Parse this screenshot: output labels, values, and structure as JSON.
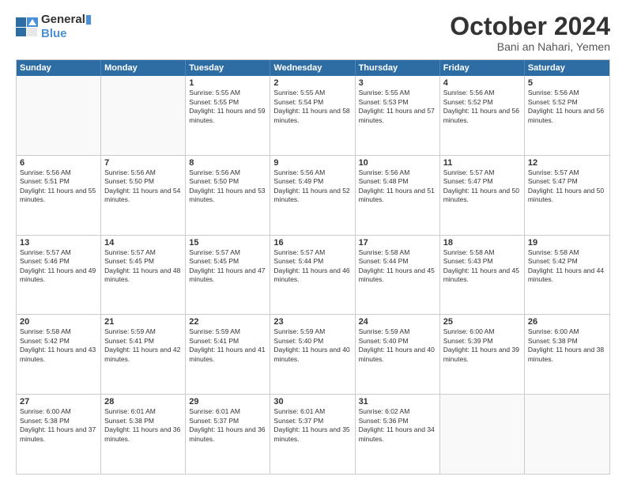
{
  "logo": {
    "line1": "General",
    "line2": "Blue"
  },
  "title": "October 2024",
  "location": "Bani an Nahari, Yemen",
  "header_days": [
    "Sunday",
    "Monday",
    "Tuesday",
    "Wednesday",
    "Thursday",
    "Friday",
    "Saturday"
  ],
  "weeks": [
    [
      {
        "day": "",
        "sunrise": "",
        "sunset": "",
        "daylight": ""
      },
      {
        "day": "",
        "sunrise": "",
        "sunset": "",
        "daylight": ""
      },
      {
        "day": "1",
        "sunrise": "Sunrise: 5:55 AM",
        "sunset": "Sunset: 5:55 PM",
        "daylight": "Daylight: 11 hours and 59 minutes."
      },
      {
        "day": "2",
        "sunrise": "Sunrise: 5:55 AM",
        "sunset": "Sunset: 5:54 PM",
        "daylight": "Daylight: 11 hours and 58 minutes."
      },
      {
        "day": "3",
        "sunrise": "Sunrise: 5:55 AM",
        "sunset": "Sunset: 5:53 PM",
        "daylight": "Daylight: 11 hours and 57 minutes."
      },
      {
        "day": "4",
        "sunrise": "Sunrise: 5:56 AM",
        "sunset": "Sunset: 5:52 PM",
        "daylight": "Daylight: 11 hours and 56 minutes."
      },
      {
        "day": "5",
        "sunrise": "Sunrise: 5:56 AM",
        "sunset": "Sunset: 5:52 PM",
        "daylight": "Daylight: 11 hours and 56 minutes."
      }
    ],
    [
      {
        "day": "6",
        "sunrise": "Sunrise: 5:56 AM",
        "sunset": "Sunset: 5:51 PM",
        "daylight": "Daylight: 11 hours and 55 minutes."
      },
      {
        "day": "7",
        "sunrise": "Sunrise: 5:56 AM",
        "sunset": "Sunset: 5:50 PM",
        "daylight": "Daylight: 11 hours and 54 minutes."
      },
      {
        "day": "8",
        "sunrise": "Sunrise: 5:56 AM",
        "sunset": "Sunset: 5:50 PM",
        "daylight": "Daylight: 11 hours and 53 minutes."
      },
      {
        "day": "9",
        "sunrise": "Sunrise: 5:56 AM",
        "sunset": "Sunset: 5:49 PM",
        "daylight": "Daylight: 11 hours and 52 minutes."
      },
      {
        "day": "10",
        "sunrise": "Sunrise: 5:56 AM",
        "sunset": "Sunset: 5:48 PM",
        "daylight": "Daylight: 11 hours and 51 minutes."
      },
      {
        "day": "11",
        "sunrise": "Sunrise: 5:57 AM",
        "sunset": "Sunset: 5:47 PM",
        "daylight": "Daylight: 11 hours and 50 minutes."
      },
      {
        "day": "12",
        "sunrise": "Sunrise: 5:57 AM",
        "sunset": "Sunset: 5:47 PM",
        "daylight": "Daylight: 11 hours and 50 minutes."
      }
    ],
    [
      {
        "day": "13",
        "sunrise": "Sunrise: 5:57 AM",
        "sunset": "Sunset: 5:46 PM",
        "daylight": "Daylight: 11 hours and 49 minutes."
      },
      {
        "day": "14",
        "sunrise": "Sunrise: 5:57 AM",
        "sunset": "Sunset: 5:45 PM",
        "daylight": "Daylight: 11 hours and 48 minutes."
      },
      {
        "day": "15",
        "sunrise": "Sunrise: 5:57 AM",
        "sunset": "Sunset: 5:45 PM",
        "daylight": "Daylight: 11 hours and 47 minutes."
      },
      {
        "day": "16",
        "sunrise": "Sunrise: 5:57 AM",
        "sunset": "Sunset: 5:44 PM",
        "daylight": "Daylight: 11 hours and 46 minutes."
      },
      {
        "day": "17",
        "sunrise": "Sunrise: 5:58 AM",
        "sunset": "Sunset: 5:44 PM",
        "daylight": "Daylight: 11 hours and 45 minutes."
      },
      {
        "day": "18",
        "sunrise": "Sunrise: 5:58 AM",
        "sunset": "Sunset: 5:43 PM",
        "daylight": "Daylight: 11 hours and 45 minutes."
      },
      {
        "day": "19",
        "sunrise": "Sunrise: 5:58 AM",
        "sunset": "Sunset: 5:42 PM",
        "daylight": "Daylight: 11 hours and 44 minutes."
      }
    ],
    [
      {
        "day": "20",
        "sunrise": "Sunrise: 5:58 AM",
        "sunset": "Sunset: 5:42 PM",
        "daylight": "Daylight: 11 hours and 43 minutes."
      },
      {
        "day": "21",
        "sunrise": "Sunrise: 5:59 AM",
        "sunset": "Sunset: 5:41 PM",
        "daylight": "Daylight: 11 hours and 42 minutes."
      },
      {
        "day": "22",
        "sunrise": "Sunrise: 5:59 AM",
        "sunset": "Sunset: 5:41 PM",
        "daylight": "Daylight: 11 hours and 41 minutes."
      },
      {
        "day": "23",
        "sunrise": "Sunrise: 5:59 AM",
        "sunset": "Sunset: 5:40 PM",
        "daylight": "Daylight: 11 hours and 40 minutes."
      },
      {
        "day": "24",
        "sunrise": "Sunrise: 5:59 AM",
        "sunset": "Sunset: 5:40 PM",
        "daylight": "Daylight: 11 hours and 40 minutes."
      },
      {
        "day": "25",
        "sunrise": "Sunrise: 6:00 AM",
        "sunset": "Sunset: 5:39 PM",
        "daylight": "Daylight: 11 hours and 39 minutes."
      },
      {
        "day": "26",
        "sunrise": "Sunrise: 6:00 AM",
        "sunset": "Sunset: 5:38 PM",
        "daylight": "Daylight: 11 hours and 38 minutes."
      }
    ],
    [
      {
        "day": "27",
        "sunrise": "Sunrise: 6:00 AM",
        "sunset": "Sunset: 5:38 PM",
        "daylight": "Daylight: 11 hours and 37 minutes."
      },
      {
        "day": "28",
        "sunrise": "Sunrise: 6:01 AM",
        "sunset": "Sunset: 5:38 PM",
        "daylight": "Daylight: 11 hours and 36 minutes."
      },
      {
        "day": "29",
        "sunrise": "Sunrise: 6:01 AM",
        "sunset": "Sunset: 5:37 PM",
        "daylight": "Daylight: 11 hours and 36 minutes."
      },
      {
        "day": "30",
        "sunrise": "Sunrise: 6:01 AM",
        "sunset": "Sunset: 5:37 PM",
        "daylight": "Daylight: 11 hours and 35 minutes."
      },
      {
        "day": "31",
        "sunrise": "Sunrise: 6:02 AM",
        "sunset": "Sunset: 5:36 PM",
        "daylight": "Daylight: 11 hours and 34 minutes."
      },
      {
        "day": "",
        "sunrise": "",
        "sunset": "",
        "daylight": ""
      },
      {
        "day": "",
        "sunrise": "",
        "sunset": "",
        "daylight": ""
      }
    ]
  ]
}
